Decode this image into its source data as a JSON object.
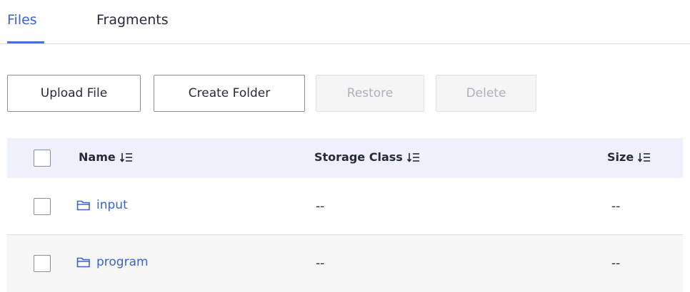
{
  "tabs": {
    "files": "Files",
    "fragments": "Fragments",
    "active": "Files"
  },
  "toolbar": {
    "upload_label": "Upload File",
    "create_label": "Create Folder",
    "restore_label": "Restore",
    "delete_label": "Delete"
  },
  "table": {
    "columns": {
      "name": "Name",
      "storage_class": "Storage Class",
      "size": "Size"
    },
    "rows": [
      {
        "name": "input",
        "storage_class": "--",
        "size": "--",
        "type_icon": "folder-icon"
      },
      {
        "name": "program",
        "storage_class": "--",
        "size": "--",
        "type_icon": "folder-icon"
      }
    ]
  },
  "colors": {
    "accent": "#3b63d0",
    "header_bg": "#eef1fb",
    "disabled_text": "#adb0b8"
  }
}
